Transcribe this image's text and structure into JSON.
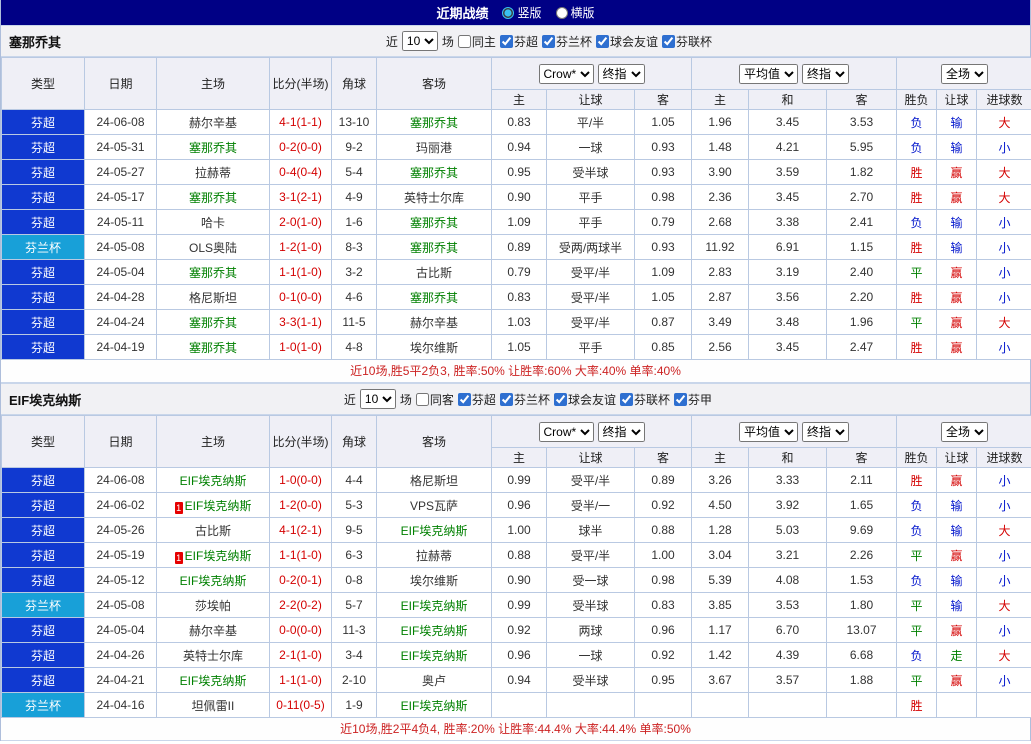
{
  "topbar": {
    "title": "近期战绩",
    "radios": [
      {
        "label": "竖版",
        "checked": true
      },
      {
        "label": "横版",
        "checked": false
      }
    ]
  },
  "columns": {
    "main": [
      "类型",
      "日期",
      "主场",
      "比分(半场)",
      "角球",
      "客场"
    ],
    "group1_selects": [
      "Crow*",
      "终指"
    ],
    "group1_sub": [
      "主",
      "让球",
      "客"
    ],
    "group2_selects": [
      "平均值",
      "终指"
    ],
    "group2_sub": [
      "主",
      "和",
      "客"
    ],
    "group3_selects": [
      "全场"
    ],
    "group3_sub": [
      "胜负",
      "让球",
      "进球数"
    ]
  },
  "colors": {
    "league": {
      "芬超": "#1039d0",
      "芬兰杯": "#18a0d8"
    },
    "win": "#d40000",
    "lose": "#0014cc",
    "draw": "#008000",
    "focus_team": "#008000",
    "score": "#d40000"
  },
  "sections": [
    {
      "team": "塞那乔其",
      "filter": {
        "near": "近",
        "count": "10",
        "unit": "场",
        "same": "同主",
        "same_checked": false,
        "leagues": [
          {
            "label": "芬超",
            "checked": true
          },
          {
            "label": "芬兰杯",
            "checked": true
          },
          {
            "label": "球会友谊",
            "checked": true
          },
          {
            "label": "芬联杯",
            "checked": true
          }
        ]
      },
      "rows": [
        {
          "league": "芬超",
          "date": "24-06-08",
          "home": "赫尔辛基",
          "home_focus": false,
          "score": "4-1(1-1)",
          "corner": "13-10",
          "away": "塞那乔其",
          "away_focus": true,
          "o1": [
            "0.83",
            "平/半",
            "1.05"
          ],
          "o2": [
            "1.96",
            "3.45",
            "3.53"
          ],
          "res": [
            "负",
            "输",
            "大"
          ]
        },
        {
          "league": "芬超",
          "date": "24-05-31",
          "home": "塞那乔其",
          "home_focus": true,
          "score": "0-2(0-0)",
          "corner": "9-2",
          "away": "玛丽港",
          "away_focus": false,
          "o1": [
            "0.94",
            "一球",
            "0.93"
          ],
          "o2": [
            "1.48",
            "4.21",
            "5.95"
          ],
          "res": [
            "负",
            "输",
            "小"
          ]
        },
        {
          "league": "芬超",
          "date": "24-05-27",
          "home": "拉赫蒂",
          "home_focus": false,
          "score": "0-4(0-4)",
          "corner": "5-4",
          "away": "塞那乔其",
          "away_focus": true,
          "o1": [
            "0.95",
            "受半球",
            "0.93"
          ],
          "o2": [
            "3.90",
            "3.59",
            "1.82"
          ],
          "res": [
            "胜",
            "赢",
            "大"
          ]
        },
        {
          "league": "芬超",
          "date": "24-05-17",
          "home": "塞那乔其",
          "home_focus": true,
          "score": "3-1(2-1)",
          "corner": "4-9",
          "away": "英特士尔库",
          "away_focus": false,
          "o1": [
            "0.90",
            "平手",
            "0.98"
          ],
          "o2": [
            "2.36",
            "3.45",
            "2.70"
          ],
          "res": [
            "胜",
            "赢",
            "大"
          ]
        },
        {
          "league": "芬超",
          "date": "24-05-11",
          "home": "哈卡",
          "home_focus": false,
          "score": "2-0(1-0)",
          "corner": "1-6",
          "away": "塞那乔其",
          "away_focus": true,
          "o1": [
            "1.09",
            "平手",
            "0.79"
          ],
          "o2": [
            "2.68",
            "3.38",
            "2.41"
          ],
          "res": [
            "负",
            "输",
            "小"
          ]
        },
        {
          "league": "芬兰杯",
          "date": "24-05-08",
          "home": "OLS奥陆",
          "home_focus": false,
          "score": "1-2(1-0)",
          "corner": "8-3",
          "away": "塞那乔其",
          "away_focus": true,
          "o1": [
            "0.89",
            "受两/两球半",
            "0.93"
          ],
          "o2": [
            "11.92",
            "6.91",
            "1.15"
          ],
          "res": [
            "胜",
            "输",
            "小"
          ]
        },
        {
          "league": "芬超",
          "date": "24-05-04",
          "home": "塞那乔其",
          "home_focus": true,
          "score": "1-1(1-0)",
          "corner": "3-2",
          "away": "古比斯",
          "away_focus": false,
          "o1": [
            "0.79",
            "受平/半",
            "1.09"
          ],
          "o2": [
            "2.83",
            "3.19",
            "2.40"
          ],
          "res": [
            "平",
            "赢",
            "小"
          ]
        },
        {
          "league": "芬超",
          "date": "24-04-28",
          "home": "格尼斯坦",
          "home_focus": false,
          "score": "0-1(0-0)",
          "corner": "4-6",
          "away": "塞那乔其",
          "away_focus": true,
          "o1": [
            "0.83",
            "受平/半",
            "1.05"
          ],
          "o2": [
            "2.87",
            "3.56",
            "2.20"
          ],
          "res": [
            "胜",
            "赢",
            "小"
          ]
        },
        {
          "league": "芬超",
          "date": "24-04-24",
          "home": "塞那乔其",
          "home_focus": true,
          "score": "3-3(1-1)",
          "corner": "11-5",
          "away": "赫尔辛基",
          "away_focus": false,
          "o1": [
            "1.03",
            "受平/半",
            "0.87"
          ],
          "o2": [
            "3.49",
            "3.48",
            "1.96"
          ],
          "res": [
            "平",
            "赢",
            "大"
          ]
        },
        {
          "league": "芬超",
          "date": "24-04-19",
          "home": "塞那乔其",
          "home_focus": true,
          "score": "1-0(1-0)",
          "corner": "4-8",
          "away": "埃尔维斯",
          "away_focus": false,
          "o1": [
            "1.05",
            "平手",
            "0.85"
          ],
          "o2": [
            "2.56",
            "3.45",
            "2.47"
          ],
          "res": [
            "胜",
            "赢",
            "小"
          ]
        }
      ],
      "summary": "近10场,胜5平2负3, 胜率:50% 让胜率:60% 大率:40% 单率:40%"
    },
    {
      "team": "EIF埃克纳斯",
      "filter": {
        "near": "近",
        "count": "10",
        "unit": "场",
        "same": "同客",
        "same_checked": false,
        "leagues": [
          {
            "label": "芬超",
            "checked": true
          },
          {
            "label": "芬兰杯",
            "checked": true
          },
          {
            "label": "球会友谊",
            "checked": true
          },
          {
            "label": "芬联杯",
            "checked": true
          },
          {
            "label": "芬甲",
            "checked": true
          }
        ]
      },
      "rows": [
        {
          "league": "芬超",
          "date": "24-06-08",
          "home": "EIF埃克纳斯",
          "home_focus": true,
          "score": "1-0(0-0)",
          "corner": "4-4",
          "away": "格尼斯坦",
          "away_focus": false,
          "o1": [
            "0.99",
            "受平/半",
            "0.89"
          ],
          "o2": [
            "3.26",
            "3.33",
            "2.11"
          ],
          "res": [
            "胜",
            "赢",
            "小"
          ]
        },
        {
          "league": "芬超",
          "date": "24-06-02",
          "home": "EIF埃克纳斯",
          "home_focus": true,
          "card": "1",
          "score": "1-2(0-0)",
          "corner": "5-3",
          "away": "VPS瓦萨",
          "away_focus": false,
          "o1": [
            "0.96",
            "受半/一",
            "0.92"
          ],
          "o2": [
            "4.50",
            "3.92",
            "1.65"
          ],
          "res": [
            "负",
            "输",
            "小"
          ]
        },
        {
          "league": "芬超",
          "date": "24-05-26",
          "home": "古比斯",
          "home_focus": false,
          "score": "4-1(2-1)",
          "corner": "9-5",
          "away": "EIF埃克纳斯",
          "away_focus": true,
          "o1": [
            "1.00",
            "球半",
            "0.88"
          ],
          "o2": [
            "1.28",
            "5.03",
            "9.69"
          ],
          "res": [
            "负",
            "输",
            "大"
          ]
        },
        {
          "league": "芬超",
          "date": "24-05-19",
          "home": "EIF埃克纳斯",
          "home_focus": true,
          "card": "1",
          "score": "1-1(1-0)",
          "corner": "6-3",
          "away": "拉赫蒂",
          "away_focus": false,
          "o1": [
            "0.88",
            "受平/半",
            "1.00"
          ],
          "o2": [
            "3.04",
            "3.21",
            "2.26"
          ],
          "res": [
            "平",
            "赢",
            "小"
          ]
        },
        {
          "league": "芬超",
          "date": "24-05-12",
          "home": "EIF埃克纳斯",
          "home_focus": true,
          "score": "0-2(0-1)",
          "corner": "0-8",
          "away": "埃尔维斯",
          "away_focus": false,
          "o1": [
            "0.90",
            "受一球",
            "0.98"
          ],
          "o2": [
            "5.39",
            "4.08",
            "1.53"
          ],
          "res": [
            "负",
            "输",
            "小"
          ]
        },
        {
          "league": "芬兰杯",
          "date": "24-05-08",
          "home": "莎埃帕",
          "home_focus": false,
          "score": "2-2(0-2)",
          "corner": "5-7",
          "away": "EIF埃克纳斯",
          "away_focus": true,
          "o1": [
            "0.99",
            "受半球",
            "0.83"
          ],
          "o2": [
            "3.85",
            "3.53",
            "1.80"
          ],
          "res": [
            "平",
            "输",
            "大"
          ]
        },
        {
          "league": "芬超",
          "date": "24-05-04",
          "home": "赫尔辛基",
          "home_focus": false,
          "score": "0-0(0-0)",
          "corner": "11-3",
          "away": "EIF埃克纳斯",
          "away_focus": true,
          "o1": [
            "0.92",
            "两球",
            "0.96"
          ],
          "o2": [
            "1.17",
            "6.70",
            "13.07"
          ],
          "res": [
            "平",
            "赢",
            "小"
          ]
        },
        {
          "league": "芬超",
          "date": "24-04-26",
          "home": "英特士尔库",
          "home_focus": false,
          "score": "2-1(1-0)",
          "corner": "3-4",
          "away": "EIF埃克纳斯",
          "away_focus": true,
          "o1": [
            "0.96",
            "一球",
            "0.92"
          ],
          "o2": [
            "1.42",
            "4.39",
            "6.68"
          ],
          "res": [
            "负",
            "走",
            "大"
          ]
        },
        {
          "league": "芬超",
          "date": "24-04-21",
          "home": "EIF埃克纳斯",
          "home_focus": true,
          "score": "1-1(1-0)",
          "corner": "2-10",
          "away": "奥卢",
          "away_focus": false,
          "o1": [
            "0.94",
            "受半球",
            "0.95"
          ],
          "o2": [
            "3.67",
            "3.57",
            "1.88"
          ],
          "res": [
            "平",
            "赢",
            "小"
          ]
        },
        {
          "league": "芬兰杯",
          "date": "24-04-16",
          "home": "坦佩雷II",
          "home_focus": false,
          "score": "0-11(0-5)",
          "corner": "1-9",
          "away": "EIF埃克纳斯",
          "away_focus": true,
          "o1": [
            "",
            "",
            ""
          ],
          "o2": [
            "",
            "",
            ""
          ],
          "res": [
            "胜",
            "",
            ""
          ]
        }
      ],
      "summary": "近10场,胜2平4负4, 胜率:20% 让胜率:44.4% 大率:44.4% 单率:50%"
    }
  ]
}
